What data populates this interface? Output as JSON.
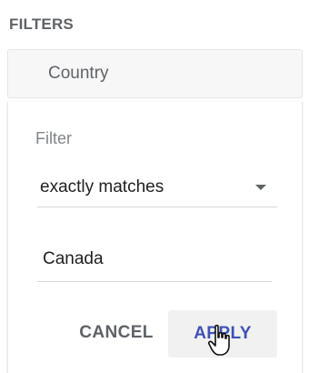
{
  "filters_panel": {
    "title": "FILTERS",
    "dimension": "Country",
    "filter_label": "Filter",
    "operator": {
      "selected": "exactly matches"
    },
    "value_input": {
      "value": "Canada"
    },
    "buttons": {
      "cancel": "CANCEL",
      "apply": "APPLY"
    }
  },
  "colors": {
    "accent": "#3f51b5",
    "muted_text": "#5f6368",
    "chip_bg": "#f7f7f7"
  },
  "icons": {
    "operator_dropdown": "dropdown-caret-icon",
    "pointer": "hand-pointer-cursor-icon"
  }
}
